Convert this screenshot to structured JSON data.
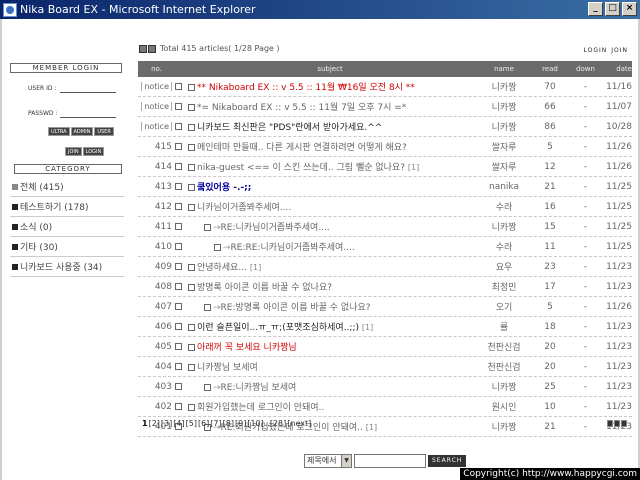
{
  "window": {
    "title": "Nika Board EX - Microsoft Internet Explorer",
    "min": "_",
    "max": "□",
    "close": "×"
  },
  "sidebar": {
    "member_header": "MEMBER LOGIN",
    "userid_label": "USER ID  :",
    "passwd_label": "PASSWD  :",
    "buttons1": [
      "ULTRA",
      "ADMIN",
      "USER"
    ],
    "buttons2": [
      "JOIN",
      "LOGIN"
    ],
    "category_header": "CATEGORY",
    "categories": [
      "전체 (415)",
      "테스트하기 (178)",
      "소식 (0)",
      "기타 (30)",
      "니카보드 사용중 (34)"
    ]
  },
  "toolbar": {
    "summary": "Total 415 articles( 1/28 Page )"
  },
  "top_links": {
    "login": "LOGIN",
    "join": "JOIN"
  },
  "table": {
    "headers": {
      "no": "no.",
      "subject": "subject",
      "name": "name",
      "read": "read",
      "down": "down",
      "date": "date"
    },
    "rows": [
      {
        "no": "notice",
        "subject": "** Nikaboard EX :: v 5.5 :: 11월 ₩16일 오전 8시 **",
        "name": "니카짱",
        "read": "70",
        "down": "-",
        "date": "11/16"
      },
      {
        "no": "notice",
        "subject": "*= Nikaboard EX :: v 5.5 :: 11월 7일 오후 7시 =*",
        "name": "니카짱",
        "read": "66",
        "down": "-",
        "date": "11/07"
      },
      {
        "no": "notice",
        "subject": "니카보드 최신판은 \"PDS\"란에서 받아가세요.^^",
        "name": "니카짱",
        "read": "86",
        "down": "-",
        "date": "10/28"
      },
      {
        "no": "415",
        "subject": "메인테마 만들때.. 다른 게시판 연결하려면 어떻게 해요?",
        "name": "쌀자루",
        "read": "5",
        "down": "-",
        "date": "11/26"
      },
      {
        "no": "414",
        "subject": "nika-guest <== 이 스킨 쓰는데.. 그림 뺄순 없나요?",
        "cnt": "[1]",
        "name": "쌀자루",
        "read": "12",
        "down": "-",
        "date": "11/26"
      },
      {
        "no": "413",
        "subject": "쿸있어용 -.-;;",
        "name": "nanika",
        "read": "21",
        "down": "-",
        "date": "11/25"
      },
      {
        "no": "412",
        "subject": "니카님이거좀봐주세여....",
        "name": "수라",
        "read": "16",
        "down": "-",
        "date": "11/25"
      },
      {
        "no": "411",
        "subject": "RE:니카님이거좀봐주세여....",
        "name": "니카짱",
        "read": "15",
        "down": "-",
        "date": "11/25"
      },
      {
        "no": "410",
        "subject": "RE:RE:니카님이거좀봐주세여....",
        "name": "수라",
        "read": "11",
        "down": "-",
        "date": "11/25"
      },
      {
        "no": "409",
        "subject": "안녕하세요...",
        "cnt": "[1]",
        "name": "요우",
        "read": "23",
        "down": "-",
        "date": "11/23"
      },
      {
        "no": "408",
        "subject": "방명록 아이콘 이름 바꿀 수 없나요?",
        "name": "최정민",
        "read": "17",
        "down": "-",
        "date": "11/23"
      },
      {
        "no": "407",
        "subject": "RE:방명록 아이콘 이름 바꿀 수 없나요?",
        "name": "오기",
        "read": "5",
        "down": "-",
        "date": "11/26"
      },
      {
        "no": "406",
        "subject": "이런 슬픈일이...ㅠ_ㅠ;(포맷조심하세여..;;)",
        "cnt": "[1]",
        "name": "률",
        "read": "18",
        "down": "-",
        "date": "11/23"
      },
      {
        "no": "405",
        "subject": "아래꺼 꼭 보세요 니카짱님",
        "name": "천판신검",
        "read": "20",
        "down": "-",
        "date": "11/23"
      },
      {
        "no": "404",
        "subject": "니카짱님 보세여",
        "name": "천판신검",
        "read": "20",
        "down": "-",
        "date": "11/23"
      },
      {
        "no": "403",
        "subject": "RE:니카짱님 보세여",
        "name": "니카짱",
        "read": "25",
        "down": "-",
        "date": "11/23"
      },
      {
        "no": "402",
        "subject": "회원가입했는데 로그인이 안돼여..",
        "name": "원시인",
        "read": "10",
        "down": "-",
        "date": "11/23"
      },
      {
        "no": "401",
        "subject": "RE:회원가입했는데 로그인이 안돼여..",
        "cnt": "[1]",
        "name": "니카짱",
        "read": "21",
        "down": "-",
        "date": "11/23"
      }
    ]
  },
  "pager": {
    "current": "1",
    "pages": [
      "[2]",
      "[3]",
      "[4]",
      "[5]",
      "[6]",
      "[7]",
      "[8]",
      "[9]",
      "[10]",
      "..[28]",
      "[next]"
    ]
  },
  "search": {
    "select_value": "제목에서",
    "button": "SEARCH"
  },
  "footer": {
    "copyright": "Copyright(c) http://www.happycgi.com"
  }
}
